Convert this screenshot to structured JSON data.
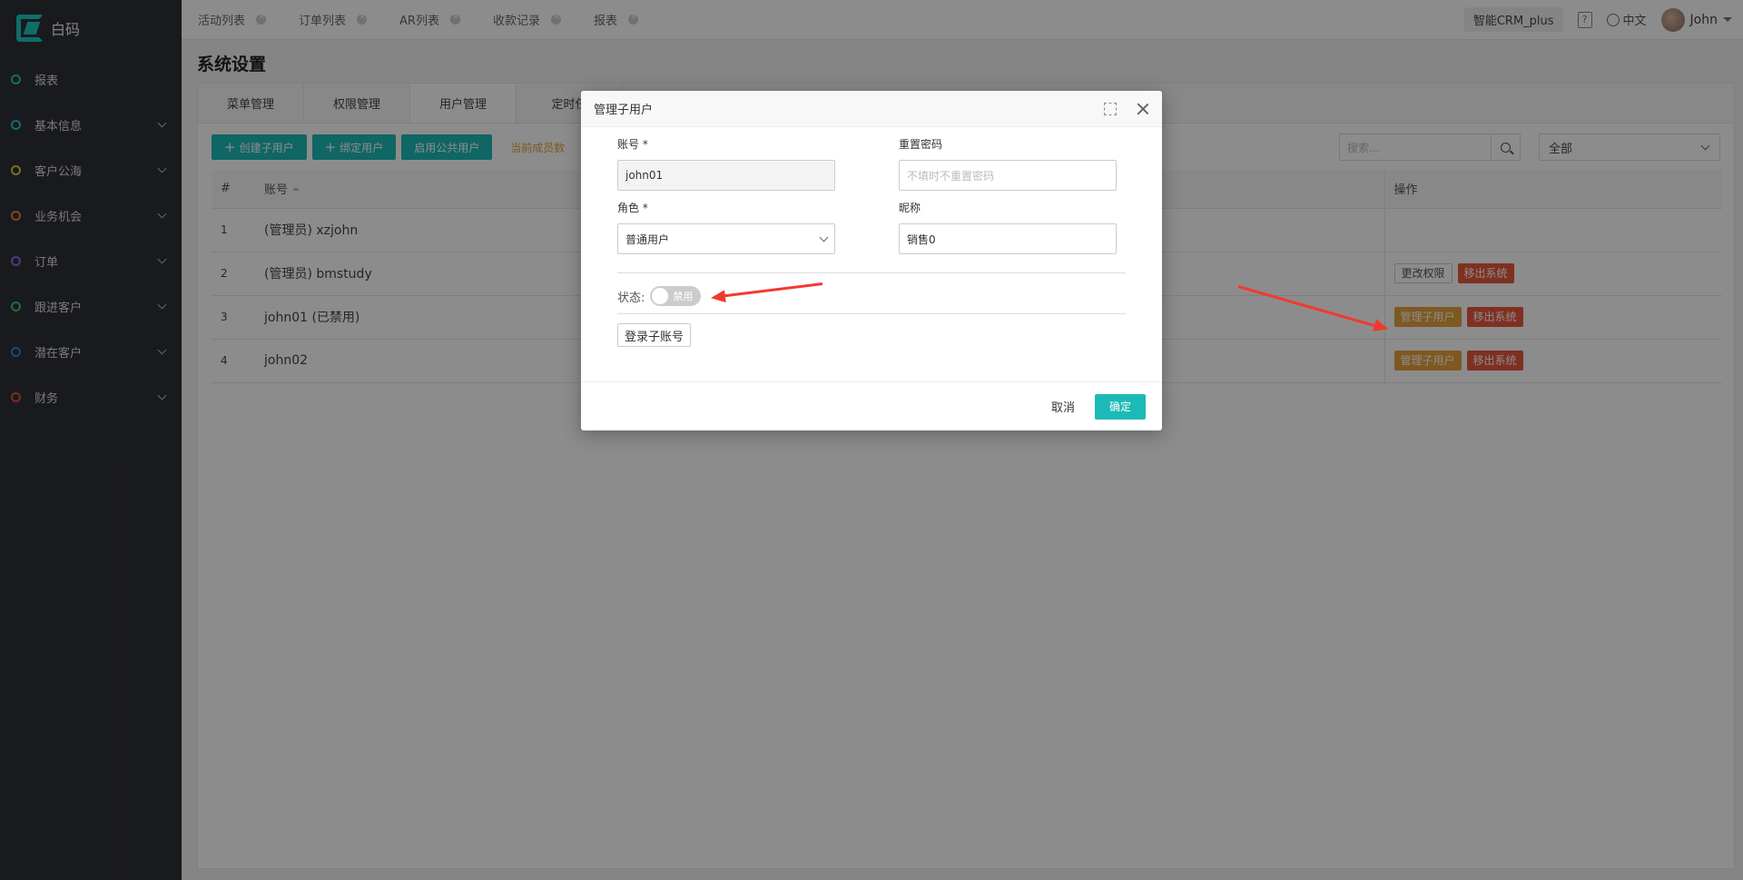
{
  "app": {
    "logo_text": "白码"
  },
  "sidebar": {
    "items": [
      {
        "label": "报表",
        "color": "#1cc6c2",
        "has_children": false
      },
      {
        "label": "基本信息",
        "color": "#1cc6c2",
        "has_children": true
      },
      {
        "label": "客户公海",
        "color": "#e6c43c",
        "has_children": true
      },
      {
        "label": "业务机会",
        "color": "#e6823c",
        "has_children": true
      },
      {
        "label": "订单",
        "color": "#8a6be6",
        "has_children": true
      },
      {
        "label": "跟进客户",
        "color": "#3cc46a",
        "has_children": true
      },
      {
        "label": "潜在客户",
        "color": "#3c7ae6",
        "has_children": true
      },
      {
        "label": "财务",
        "color": "#e6503c",
        "has_children": true
      }
    ]
  },
  "topbar": {
    "tabs": [
      "活动列表",
      "订单列表",
      "AR列表",
      "收款记录",
      "报表"
    ],
    "brand": "智能CRM_plus",
    "help_icon": "?",
    "language": "中文",
    "user_name": "John"
  },
  "page": {
    "title": "系统设置",
    "sub_tabs": [
      "菜单管理",
      "权限管理",
      "用户管理",
      "定时任"
    ],
    "toolbar": {
      "create_sub_user": "创建子用户",
      "bind_user": "绑定用户",
      "enable_public_user": "启用公共用户",
      "member_hint": "当前成员数",
      "search_placeholder": "搜索...",
      "filter_value": "全部"
    },
    "table": {
      "headers": {
        "index": "#",
        "account": "账号",
        "ops": "操作"
      },
      "rows": [
        {
          "index": "1",
          "account": "(管理员) xzjohn",
          "ops": []
        },
        {
          "index": "2",
          "account": "(管理员) bmstudy",
          "ops": [
            {
              "label": "更改权限",
              "style": "gray"
            },
            {
              "label": "移出系统",
              "style": "red"
            }
          ]
        },
        {
          "index": "3",
          "account": "john01 (已禁用)",
          "ops": [
            {
              "label": "管理子用户",
              "style": "orange"
            },
            {
              "label": "移出系统",
              "style": "red"
            }
          ]
        },
        {
          "index": "4",
          "account": "john02",
          "ops": [
            {
              "label": "管理子用户",
              "style": "orange"
            },
            {
              "label": "移出系统",
              "style": "red"
            }
          ]
        }
      ]
    }
  },
  "modal": {
    "title": "管理子用户",
    "account_label": "账号 *",
    "account_value": "john01",
    "reset_pwd_label": "重置密码",
    "reset_pwd_placeholder": "不填时不重置密码",
    "role_label": "角色 *",
    "role_value": "普通用户",
    "nickname_label": "昵称",
    "nickname_value": "销售0",
    "status_label": "状态:",
    "status_toggle": "禁用",
    "login_sub_account": "登录子账号",
    "cancel": "取消",
    "confirm": "确定"
  },
  "colors": {
    "accent": "#1cbab6",
    "warning": "#e6a23c",
    "danger": "#e8583d",
    "annotation_arrow": "#f03a2e"
  }
}
